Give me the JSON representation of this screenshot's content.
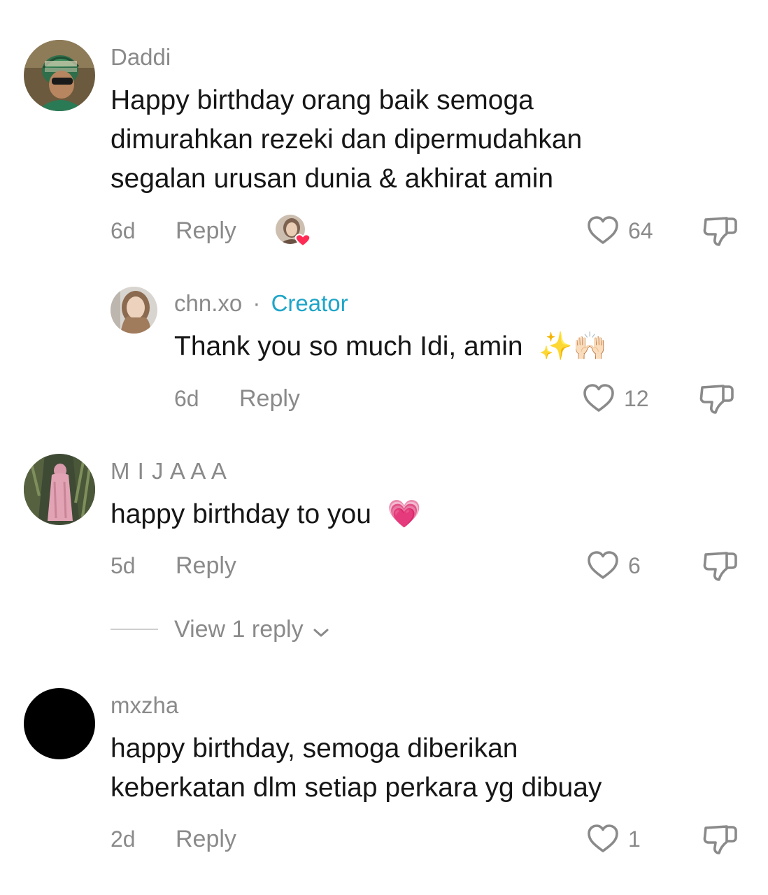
{
  "comments": [
    {
      "username": "Daddi",
      "lines": [
        "Happy birthday orang baik semoga",
        "dimurahkan rezeki dan dipermudahkan",
        "segalan urusan dunia & akhirat amin"
      ],
      "time": "6d",
      "reply_label": "Reply",
      "likes": "64",
      "creator_liked": true
    },
    {
      "username": "M I J A A A",
      "text": "happy birthday to you",
      "emoji": "💗",
      "time": "5d",
      "reply_label": "Reply",
      "likes": "6",
      "view_replies": "View 1 reply"
    },
    {
      "username": "mxzha",
      "lines": [
        "happy birthday, semoga diberikan",
        "keberkatan dlm setiap perkara yg dibuay"
      ],
      "time": "2d",
      "reply_label": "Reply",
      "likes": "1"
    }
  ],
  "reply": {
    "username": "chn.xo",
    "separator": "·",
    "badge": "Creator",
    "text": "Thank you so much Idi, amin",
    "emoji": "✨🙌🏻",
    "time": "6d",
    "reply_label": "Reply",
    "likes": "12"
  },
  "colors": {
    "meta_gray": "#8a8a8a",
    "creator_accent": "#1ea5c8",
    "like_heart": "#fe2c55"
  }
}
